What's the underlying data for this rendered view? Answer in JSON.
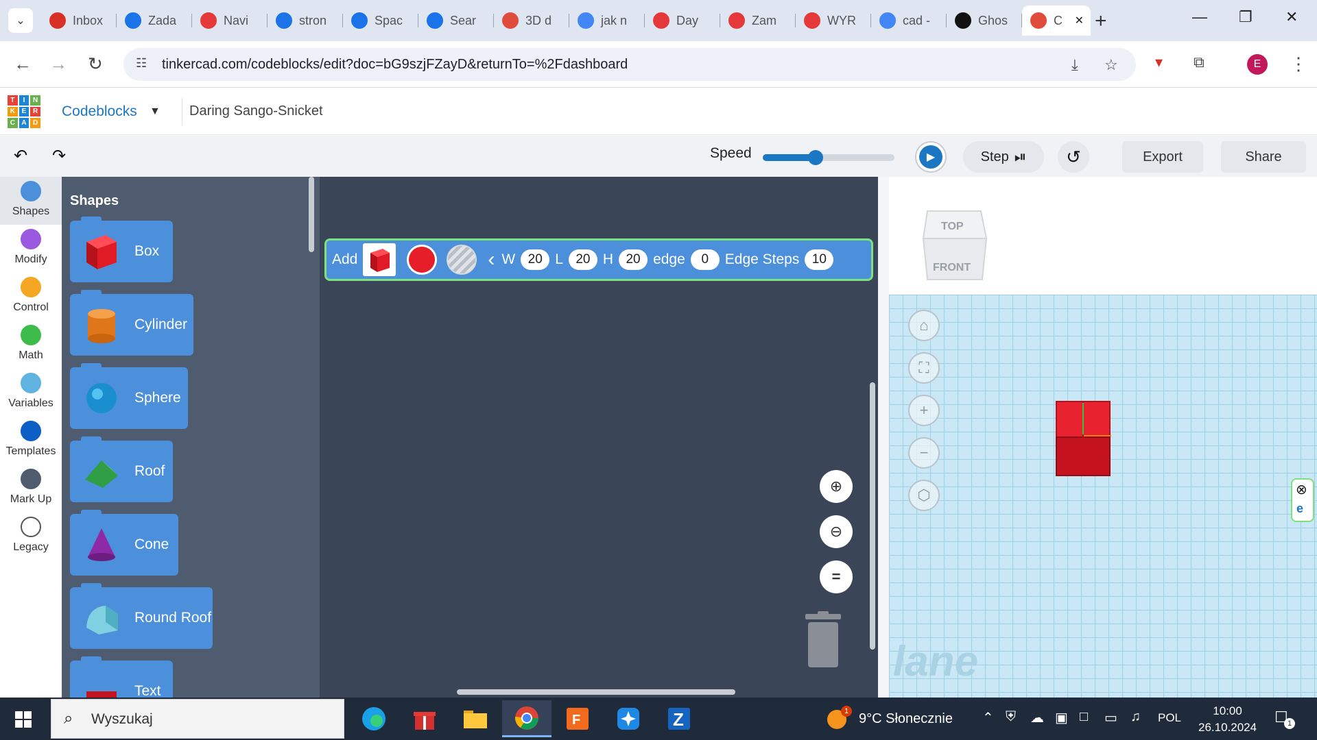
{
  "browser": {
    "tabs": [
      {
        "label": "Inbox",
        "icon": "gmail-icon",
        "color": "#d93025"
      },
      {
        "label": "Zada",
        "icon": "classroom-icon",
        "color": "#1a73e8"
      },
      {
        "label": "Navi",
        "icon": "youtube-icon",
        "color": "#e5383b"
      },
      {
        "label": "stron",
        "icon": "contact-icon",
        "color": "#1a73e8"
      },
      {
        "label": "Spac",
        "icon": "spaces-icon",
        "color": "#1a73e8"
      },
      {
        "label": "Sear",
        "icon": "search-t-icon",
        "color": "#1a73e8"
      },
      {
        "label": "3D d",
        "icon": "tinkercad-icon",
        "color": "#e14b3b"
      },
      {
        "label": "jak n",
        "icon": "google-icon",
        "color": "#4285f4"
      },
      {
        "label": "Day",
        "icon": "youtube-icon",
        "color": "#e5383b"
      },
      {
        "label": "Zam",
        "icon": "youtube-icon",
        "color": "#e5383b"
      },
      {
        "label": "WYR",
        "icon": "youtube-icon",
        "color": "#e5383b"
      },
      {
        "label": "cad -",
        "icon": "google-icon",
        "color": "#4285f4"
      },
      {
        "label": "Ghos",
        "icon": "ghost-icon",
        "color": "#111111"
      },
      {
        "label": "C",
        "icon": "tinkercad-icon",
        "color": "#e14b3b",
        "active": true
      }
    ],
    "url": "tinkercad.com/codeblocks/edit?doc=bG9szjFZayD&returnTo=%2Fdashboard",
    "profile_initial": "E"
  },
  "header": {
    "logo_letters": [
      "T",
      "I",
      "N",
      "K",
      "E",
      "R",
      "C",
      "A",
      "D"
    ],
    "logo_colors": [
      "#e6443a",
      "#1d86d2",
      "#6ab04c",
      "#f39c12",
      "#1d86d2",
      "#e6443a",
      "#6ab04c",
      "#1d86d2",
      "#f39c12"
    ],
    "app_menu": "Codeblocks",
    "doc_title": "Daring Sango-Snicket"
  },
  "toolbar": {
    "speed_label": "Speed",
    "speed_value": 0.4,
    "step_label": "Step",
    "export_label": "Export",
    "share_label": "Share"
  },
  "categories": [
    {
      "label": "Shapes",
      "color": "#4c8fdb",
      "active": true
    },
    {
      "label": "Modify",
      "color": "#9b59e0"
    },
    {
      "label": "Control",
      "color": "#f5a623"
    },
    {
      "label": "Math",
      "color": "#3dbb4b"
    },
    {
      "label": "Variables",
      "color": "#5fb3e0"
    },
    {
      "label": "Templates",
      "color": "#0c5fc4"
    },
    {
      "label": "Mark Up",
      "color": "#4f5b6e"
    },
    {
      "label": "Legacy",
      "color": "#ffffff"
    }
  ],
  "palette": {
    "title": "Shapes",
    "blocks": [
      {
        "label": "Box",
        "shape": "box-icon"
      },
      {
        "label": "Cylinder",
        "shape": "cylinder-icon"
      },
      {
        "label": "Sphere",
        "shape": "sphere-icon"
      },
      {
        "label": "Roof",
        "shape": "roof-icon"
      },
      {
        "label": "Cone",
        "shape": "cone-icon"
      },
      {
        "label": "Round Roof",
        "shape": "round-roof-icon"
      },
      {
        "label": "Text",
        "shape": "text-icon"
      }
    ]
  },
  "add_block": {
    "add_label": "Add",
    "w_label": "W",
    "w_value": "20",
    "l_label": "L",
    "l_value": "20",
    "h_label": "H",
    "h_value": "20",
    "edge_label": "edge",
    "edge_value": "0",
    "edge_steps_label": "Edge Steps",
    "edge_steps_value": "10",
    "color": "#e61e2a"
  },
  "viewport": {
    "viewcube_top": "TOP",
    "viewcube_front": "FRONT",
    "plane_text": "lane"
  },
  "taskbar": {
    "search_placeholder": "Wyszukaj",
    "weather_badge": "1",
    "weather": "9°C  Słonecznie",
    "language": "POL",
    "time": "10:00",
    "date": "26.10.2024",
    "notification_count": "1"
  }
}
